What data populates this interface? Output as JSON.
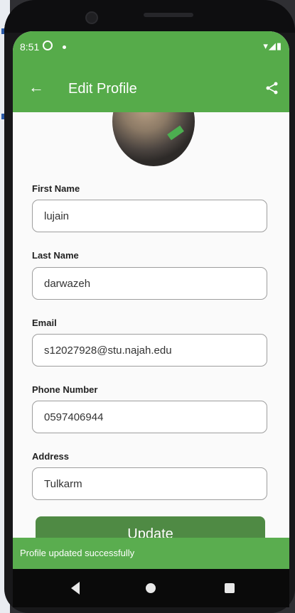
{
  "status_bar": {
    "time": "8:51",
    "icons": "▾◢▮"
  },
  "app_bar": {
    "back_glyph": "←",
    "title": "Edit Profile"
  },
  "form": {
    "first_name": {
      "label": "First Name",
      "value": "lujain"
    },
    "last_name": {
      "label": "Last Name",
      "value": "darwazeh"
    },
    "email": {
      "label": "Email",
      "value": "s12027928@stu.najah.edu"
    },
    "phone": {
      "label": "Phone Number",
      "value": "0597406944"
    },
    "address": {
      "label": "Address",
      "value": "Tulkarm"
    }
  },
  "update_button": {
    "label": "Update"
  },
  "snackbar": {
    "message": "Profile updated successfully"
  },
  "colors": {
    "primary": "#56ab4a",
    "button": "#4f8a44",
    "snackbar": "#5aad4f"
  },
  "icons": [
    "back-arrow-icon",
    "share-icon",
    "whatsapp-icon",
    "wifi-icon",
    "signal-icon",
    "battery-icon",
    "nav-back-icon",
    "nav-home-icon",
    "nav-recents-icon"
  ]
}
